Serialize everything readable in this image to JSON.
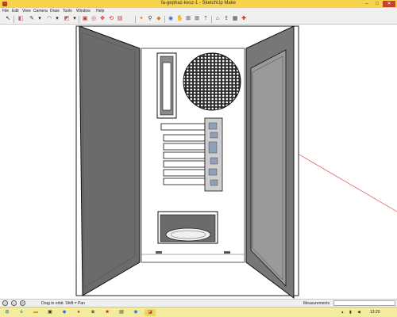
{
  "window": {
    "title": "fa-gephaz-kesz-1 - SketchUp Make",
    "min_glyph": "–",
    "max_glyph": "□",
    "close_glyph": "✕"
  },
  "menu": [
    "File",
    "Edit",
    "View",
    "Camera",
    "Draw",
    "Tools",
    "Window",
    "Help"
  ],
  "toolbar": {
    "tools": [
      {
        "name": "select-tool-icon",
        "glyph": "↖",
        "color": "#222222"
      },
      {
        "name": "eraser-tool-icon",
        "glyph": "◧",
        "color": "#d04a7a"
      },
      {
        "name": "line-tool-icon",
        "glyph": "✎",
        "color": "#3a3a3a"
      },
      {
        "name": "arc-tool-icon",
        "glyph": "◠",
        "color": "#a04020"
      },
      {
        "name": "shape-tool-icon",
        "glyph": "◩",
        "color": "#b05050"
      },
      {
        "name": "push-pull-icon",
        "glyph": "▣",
        "color": "#c03030"
      },
      {
        "name": "offset-icon",
        "glyph": "◎",
        "color": "#c04040"
      },
      {
        "name": "move-icon",
        "glyph": "✥",
        "color": "#d02020"
      },
      {
        "name": "rotate-icon",
        "glyph": "⟲",
        "color": "#c02020"
      },
      {
        "name": "scale-icon",
        "glyph": "▤",
        "color": "#c03030"
      },
      {
        "name": "orbit-icon",
        "glyph": "◉",
        "color": "#2a6ad0"
      },
      {
        "name": "zoom-icon",
        "glyph": "⚲",
        "color": "#3a3a3a"
      },
      {
        "name": "zoom-extents-icon",
        "glyph": "⊞",
        "color": "#3a3a3a"
      },
      {
        "name": "tape-measure-icon",
        "glyph": "✦",
        "color": "#d09020"
      },
      {
        "name": "paint-bucket-icon",
        "glyph": "◆",
        "color": "#d08020"
      },
      {
        "name": "walk-icon",
        "glyph": "⇡",
        "color": "#3060c0"
      },
      {
        "name": "pan-icon",
        "glyph": "✋",
        "color": "#3a3a3a"
      },
      {
        "name": "look-around-icon",
        "glyph": "◍",
        "color": "#3a3a3a"
      },
      {
        "name": "position-camera-icon",
        "glyph": "⌖",
        "color": "#3a3a3a"
      },
      {
        "name": "section-plane-icon",
        "glyph": "⧉",
        "color": "#3a3a3a"
      },
      {
        "name": "warehouse-icon",
        "glyph": "⌂",
        "color": "#3a3a3a"
      },
      {
        "name": "share-model-icon",
        "glyph": "⇪",
        "color": "#3a3a3a"
      },
      {
        "name": "components-icon",
        "glyph": "▦",
        "color": "#3a3a3a"
      },
      {
        "name": "extension-icon",
        "glyph": "✚",
        "color": "#c02020"
      }
    ]
  },
  "statusbar": {
    "hint": "Drag to orbit.  Shift = Pan",
    "measurements_label": "Measurements",
    "measurements_value": ""
  },
  "taskbar": {
    "clock": "13:20"
  },
  "colors": {
    "titlebar": "#f6d34a",
    "taskbar": "#f2ec9c",
    "case_interior": "#ffffff",
    "side_panel": "#6b6b6b",
    "fan_grill": "#2b2b2b",
    "axis_red": "#d9534f"
  }
}
